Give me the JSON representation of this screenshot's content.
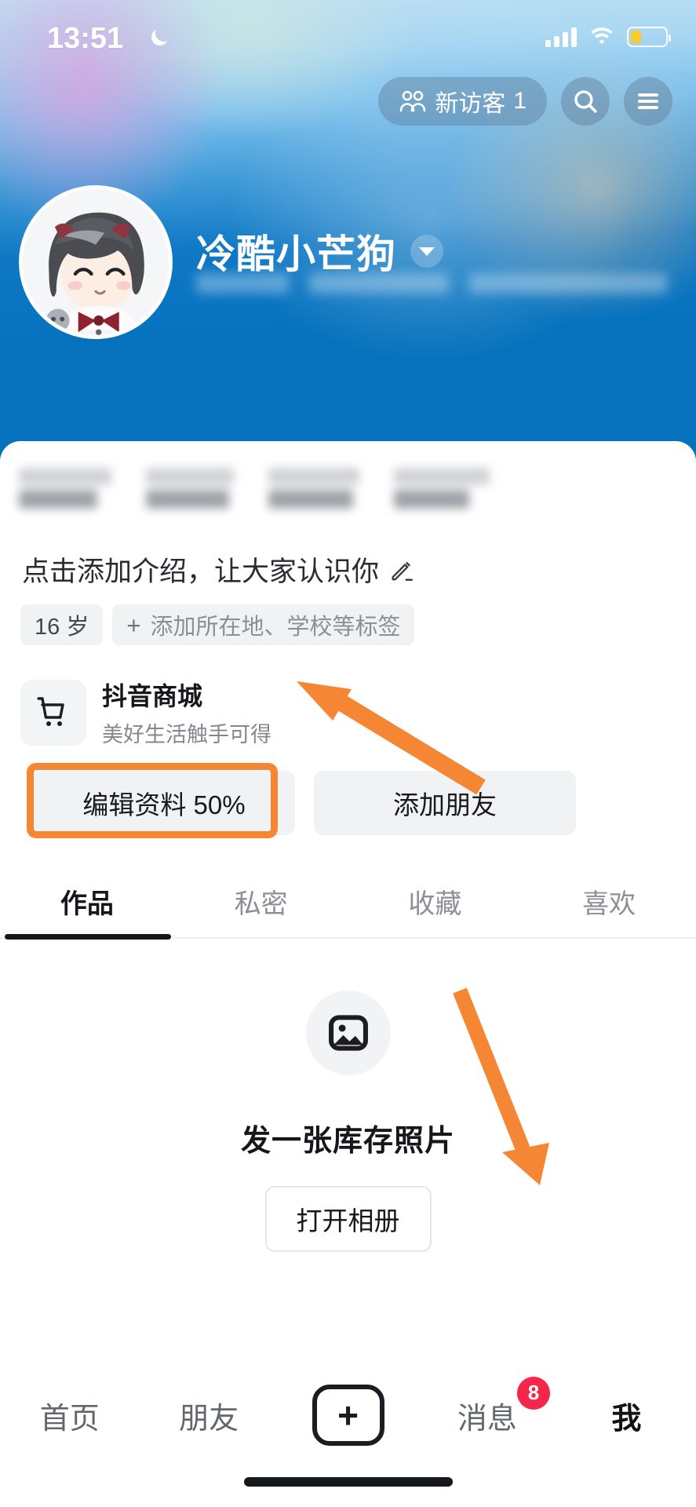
{
  "status_bar": {
    "time": "13:51",
    "moon_icon": "crescent-moon-icon",
    "signal_icon": "cellular-signal-icon",
    "wifi_icon": "wifi-icon",
    "battery_icon": "battery-low-icon",
    "battery_level_pct": 30
  },
  "header": {
    "visitors_label": "新访客",
    "visitors_count": "1",
    "visitors_icon": "two-people-icon",
    "search_icon": "search-icon",
    "menu_icon": "hamburger-menu-icon"
  },
  "profile": {
    "display_name": "冷酷小芒狗",
    "name_chevron_icon": "chevron-down-icon",
    "avatar_alt": "anime-girl-avatar",
    "subtitle_blurred": true
  },
  "stats": {
    "blurred": true,
    "items": [
      "",
      "",
      "",
      ""
    ]
  },
  "bio": {
    "placeholder_text": "点击添加介绍，让大家认识你",
    "edit_icon": "pencil-icon"
  },
  "tags": {
    "age": "16 岁",
    "add_tag_plus": "+",
    "add_tag_label": "添加所在地、学校等标签"
  },
  "mall": {
    "icon": "shopping-cart-icon",
    "title": "抖音商城",
    "subtitle": "美好生活触手可得"
  },
  "actions": {
    "edit_profile": "编辑资料 50%",
    "add_friend": "添加朋友"
  },
  "tabs": {
    "items": [
      "作品",
      "私密",
      "收藏",
      "喜欢"
    ],
    "active_index": 0
  },
  "empty_state": {
    "icon": "image-placeholder-icon",
    "title": "发一张库存照片",
    "button_label": "打开相册"
  },
  "bottom_nav": {
    "items": [
      {
        "label": "首页",
        "icon": "",
        "active": false
      },
      {
        "label": "朋友",
        "icon": "",
        "active": false
      },
      {
        "label": "",
        "icon": "plus-box-icon",
        "active": false
      },
      {
        "label": "消息",
        "icon": "",
        "active": false,
        "badge": "8"
      },
      {
        "label": "我",
        "icon": "",
        "active": true
      }
    ]
  },
  "annotations": {
    "highlight_color": "#f58634",
    "highlight_target": "编辑资料 50%",
    "arrow_1_points_to": "编辑资料 50%",
    "arrow_2_points_to": "我"
  },
  "colors": {
    "banner_blue": "#0671bc",
    "accent_orange": "#f58634",
    "badge_red": "#f5264a",
    "text_primary": "#15171a",
    "text_muted": "#8b8f96",
    "chip_bg": "#f1f2f4"
  }
}
